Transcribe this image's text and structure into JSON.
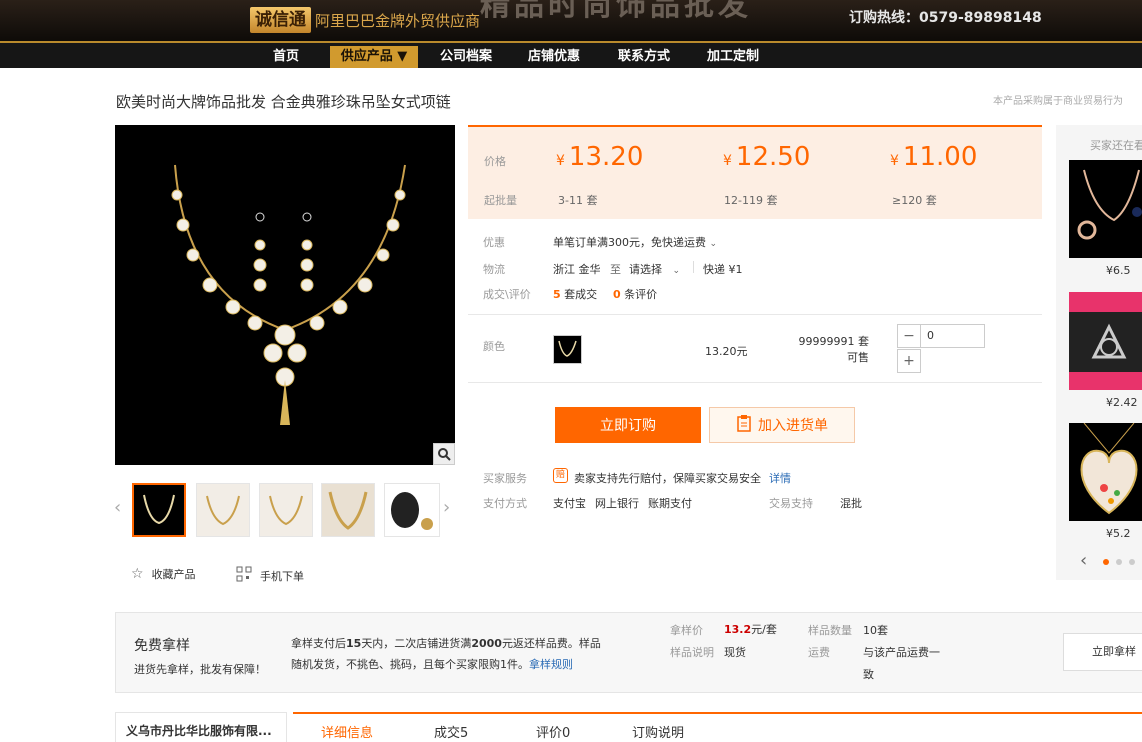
{
  "header": {
    "logo_mark": "诚信通",
    "logo_sub": "阿里巴巴金牌外贸供应商",
    "banner_text": "精品时尚饰品批发",
    "hotline": "订购热线：0579-89898148"
  },
  "nav": {
    "items": [
      "首页",
      "供应产品 ▼",
      "公司档案",
      "店铺优惠",
      "联系方式",
      "加工定制"
    ],
    "active_index": 1
  },
  "product": {
    "title": "欧美时尚大牌饰品批发 合金典雅珍珠吊坠女式项链",
    "note": "本产品采购属于商业贸易行为"
  },
  "price": {
    "price_label": "价格",
    "qty_label": "起批量",
    "currency": "¥",
    "tiers": [
      {
        "price": "13.20",
        "qty": "3-11 套"
      },
      {
        "price": "12.50",
        "qty": "12-119 套"
      },
      {
        "price": "11.00",
        "qty": "≥120 套"
      }
    ]
  },
  "info": {
    "promo_label": "优惠",
    "promo_value": "单笔订单满300元，免快递运费",
    "logistics_label": "物流",
    "from": "浙江 金华",
    "to_label": "至",
    "select": "请选择",
    "express": "快递 ¥1",
    "deals_label": "成交\\评价",
    "deals_count": "5",
    "deals_unit": "套成交",
    "reviews_count": "0",
    "reviews_unit": "条评价"
  },
  "sku": {
    "color_label": "颜色",
    "price": "13.20元",
    "stock": "99999991 套可售",
    "qty_value": "0",
    "minus": "−",
    "plus": "+"
  },
  "actions": {
    "buy_label": "立即订购",
    "cart_label": "加入进货单"
  },
  "service": {
    "label": "买家服务",
    "badge": "赔",
    "text": "卖家支持先行赔付，保障买家交易安全",
    "link": "详情",
    "pay_label": "支付方式",
    "pay_methods": [
      "支付宝",
      "网上银行",
      "账期支付"
    ],
    "trade_label": "交易支持",
    "trade_value": "混批"
  },
  "gallery": {
    "prev": "‹",
    "next": "›"
  },
  "favorites": {
    "fav_label": "收藏产品",
    "mobile_label": "手机下单"
  },
  "sidebar": {
    "title": "买家还在看",
    "prices": [
      "¥6.5",
      "¥2.42",
      "¥5.2"
    ],
    "prev": "‹"
  },
  "sample": {
    "title": "免费拿样",
    "subtitle": "进货先拿样，批发有保障！",
    "desc_1": "拿样支付后",
    "desc_days": "15",
    "desc_2": "天内，二次店铺进货满",
    "desc_amount": "2000",
    "desc_3": "元返还样品费。样品",
    "desc_line2": "随机发货，不挑色、挑码，且每个买家限购1件。",
    "rules_link": "拿样规则",
    "price_label": "拿样价",
    "price_value": "13.2",
    "price_unit": "元/套",
    "qty_label": "样品数量",
    "qty_value": "10套",
    "desc_label": "样品说明",
    "desc_value": "现货",
    "ship_label": "运费",
    "ship_value_1": "与该产品运费一",
    "ship_value_2": "致",
    "button": "立即拿样"
  },
  "company": {
    "name": "义乌市丹比华比服饰有限..."
  },
  "tabs": [
    "详细信息",
    "成交5",
    "评价0",
    "订购说明"
  ],
  "colors": {
    "accent": "#ff6600",
    "gold": "#d19a2e",
    "dark": "#161616"
  }
}
